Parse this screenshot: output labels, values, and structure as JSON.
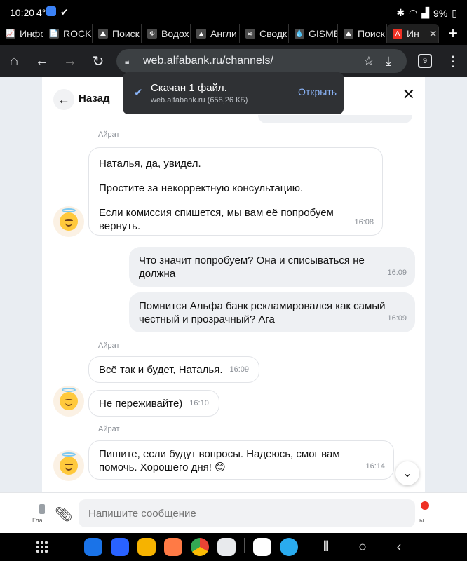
{
  "status_bar": {
    "time": "10:20",
    "temperature": "4°",
    "battery": "9%"
  },
  "tabs": [
    {
      "label": "Инфор",
      "favicon": "📈"
    },
    {
      "label": "ROCK",
      "favicon": "📄"
    },
    {
      "label": "Поиск",
      "favicon": "⛰"
    },
    {
      "label": "Водох",
      "favicon": "Ф"
    },
    {
      "label": "Англи",
      "favicon": "▲"
    },
    {
      "label": "Сводк",
      "favicon": "≋"
    },
    {
      "label": "GISME",
      "favicon": "💧"
    },
    {
      "label": "Поиск",
      "favicon": "⛰"
    },
    {
      "label": "Ин",
      "favicon": "А",
      "active": true,
      "close": "✕"
    }
  ],
  "toolbar": {
    "url": "web.alfabank.ru/channels/",
    "tab_count": "9"
  },
  "download_toast": {
    "title": "Скачан 1 файл.",
    "subtitle": "web.alfabank.ru (658,26 КБ)",
    "action": "Открыть"
  },
  "chat": {
    "back_label": "Назад",
    "author_name": "Айрат",
    "messages": [
      {
        "paragraphs": [
          "Наталья, да, увидел.",
          "Простите за некорректную консультацию.",
          "Если комиссия спишется, мы вам её попробуем вернуть."
        ],
        "time": "16:08"
      },
      {
        "text": "Что значит попробуем? Она и списываться не должна",
        "time": "16:09"
      },
      {
        "text": "Помнится Альфа банк рекламировался как самый честный и прозрачный? Ага",
        "time": "16:09"
      },
      {
        "text": "Всё так и будет, Наталья.",
        "time": "16:09"
      },
      {
        "text": "Не переживайте)",
        "time": "16:10"
      },
      {
        "text": "Пишите, если будут вопросы. Надеюсь, смог вам помочь. Хорошего дня! 😊",
        "time": "16:14"
      }
    ]
  },
  "composer": {
    "placeholder": "Напишите сообщение",
    "under_left": "Гла",
    "under_right": "ы"
  },
  "colors": {
    "accent_blue": "#8ab4f8",
    "brand_red": "#ef3124",
    "bubble_out": "#eef0f3"
  }
}
